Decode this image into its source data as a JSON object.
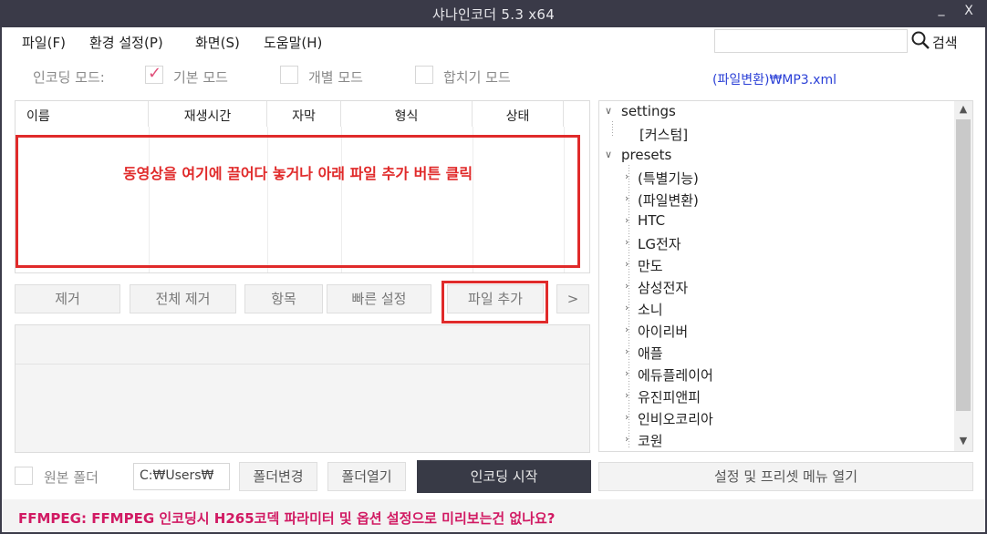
{
  "window": {
    "title": "샤나인코더  5.3  x64",
    "minimize": "_",
    "close": "X"
  },
  "menu": {
    "items": [
      "파일(F)",
      "환경 설정(P)",
      "화면(S)",
      "도움말(H)"
    ],
    "search_value": "",
    "search_label": "검색"
  },
  "mode": {
    "label": "인코딩 모드:",
    "options": [
      {
        "label": "기본 모드",
        "checked": true
      },
      {
        "label": "개별 모드",
        "checked": false
      },
      {
        "label": "합치기 모드",
        "checked": false
      }
    ],
    "preset_path": "(파일변환)₩MP3.xml"
  },
  "file_list": {
    "columns": [
      "이름",
      "재생시간",
      "자막",
      "형식",
      "상태"
    ],
    "drop_hint": "동영상을 여기에 끌어다 놓거나 아래 파일 추가 버튼 클릭"
  },
  "actions": {
    "remove": "제거",
    "remove_all": "전체 제거",
    "items": "항목",
    "quick_settings": "빠른 설정",
    "add_file": "파일 추가",
    "more": ">"
  },
  "tree": {
    "nodes": [
      {
        "label": "settings",
        "level": 0,
        "expanded": true
      },
      {
        "label": "[커스텀]",
        "level": 1
      },
      {
        "label": "presets",
        "level": 0,
        "expanded": true
      },
      {
        "label": "(특별기능)",
        "level": 1
      },
      {
        "label": "(파일변환)",
        "level": 1
      },
      {
        "label": "HTC",
        "level": 1
      },
      {
        "label": "LG전자",
        "level": 1
      },
      {
        "label": "만도",
        "level": 1
      },
      {
        "label": "삼성전자",
        "level": 1
      },
      {
        "label": "소니",
        "level": 1
      },
      {
        "label": "아이리버",
        "level": 1
      },
      {
        "label": "애플",
        "level": 1
      },
      {
        "label": "에듀플레이어",
        "level": 1
      },
      {
        "label": "유진피앤피",
        "level": 1
      },
      {
        "label": "인비오코리아",
        "level": 1
      },
      {
        "label": "코원",
        "level": 1
      }
    ]
  },
  "output": {
    "original_folder_label": "원본 폴더",
    "path": "C:₩Users₩",
    "change_folder": "폴더변경",
    "open_folder": "폴더열기",
    "start_encoding": "인코딩 시작",
    "open_menu": "설정 및 프리셋 메뉴 열기"
  },
  "status": {
    "message": "FFMPEG: FFMPEG 인코딩시 H265코덱 파라미터 및 옵션 설정으로 미리보는건 없나요?"
  },
  "colors": {
    "accent_red": "#e02a2a",
    "link_blue": "#2a3fd6",
    "status_pink": "#d11a63",
    "dark_button": "#383a46"
  }
}
